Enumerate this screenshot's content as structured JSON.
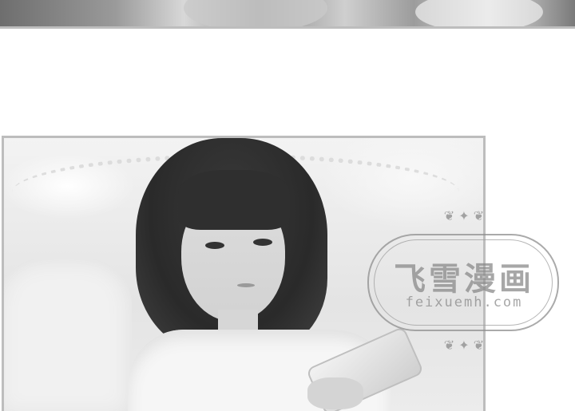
{
  "watermark": {
    "title": "飞雪漫画",
    "url": "feixuemh.com",
    "ornament_top": "❦ ✦ ❦",
    "ornament_bottom": "❦ ✦ ❦"
  },
  "colors": {
    "panel_border": "#bdbdbd",
    "watermark": "#8a8a8a",
    "background": "#ffffff"
  }
}
